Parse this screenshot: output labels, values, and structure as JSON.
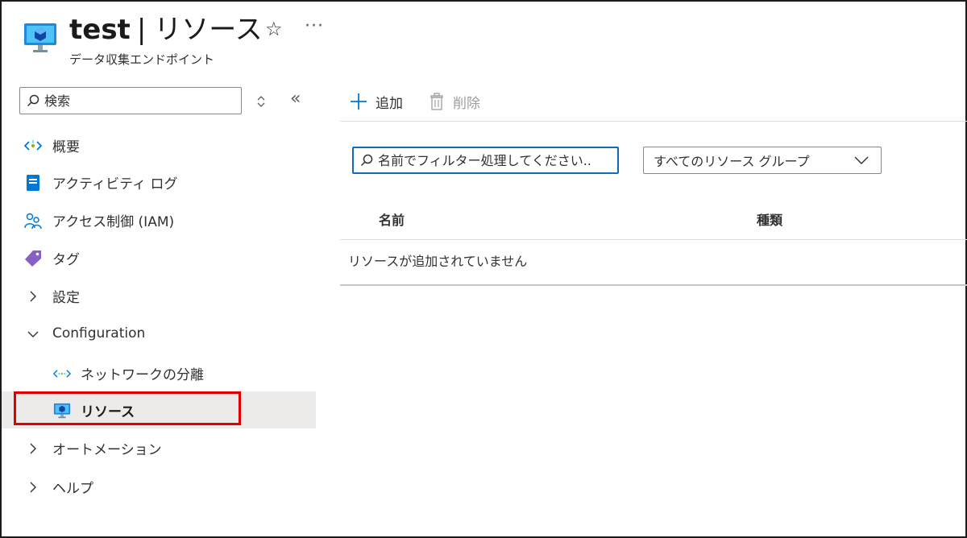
{
  "header": {
    "resource_name": "test",
    "separator": "|",
    "page_name": "リソース",
    "subtitle": "データ収集エンドポイント",
    "favorite_icon": "star-icon",
    "more_label": "···"
  },
  "sidebar": {
    "search_placeholder": "検索",
    "collapse_label": "«",
    "items": [
      {
        "label": "概要",
        "icon": "overview-icon"
      },
      {
        "label": "アクティビティ ログ",
        "icon": "activity-log-icon"
      },
      {
        "label": "アクセス制御 (IAM)",
        "icon": "iam-icon"
      },
      {
        "label": "タグ",
        "icon": "tag-icon"
      },
      {
        "label": "設定",
        "icon": "chevron-right-icon"
      },
      {
        "label": "Configuration",
        "icon": "chevron-down-icon"
      },
      {
        "label": "ネットワークの分離",
        "icon": "network-isolation-icon"
      },
      {
        "label": "リソース",
        "icon": "resource-icon",
        "selected": true
      },
      {
        "label": "オートメーション",
        "icon": "chevron-right-icon"
      },
      {
        "label": "ヘルプ",
        "icon": "chevron-right-icon"
      }
    ]
  },
  "toolbar": {
    "add_label": "追加",
    "delete_label": "削除"
  },
  "filter": {
    "placeholder": "名前でフィルター処理してください..",
    "group_dropdown_value": "すべてのリソース グループ"
  },
  "table": {
    "columns": [
      "名前",
      "種類"
    ],
    "empty_message": "リソースが追加されていません"
  },
  "colors": {
    "accent": "#0078d4",
    "highlight": "#e00000",
    "selected_bg": "#edebe9"
  }
}
